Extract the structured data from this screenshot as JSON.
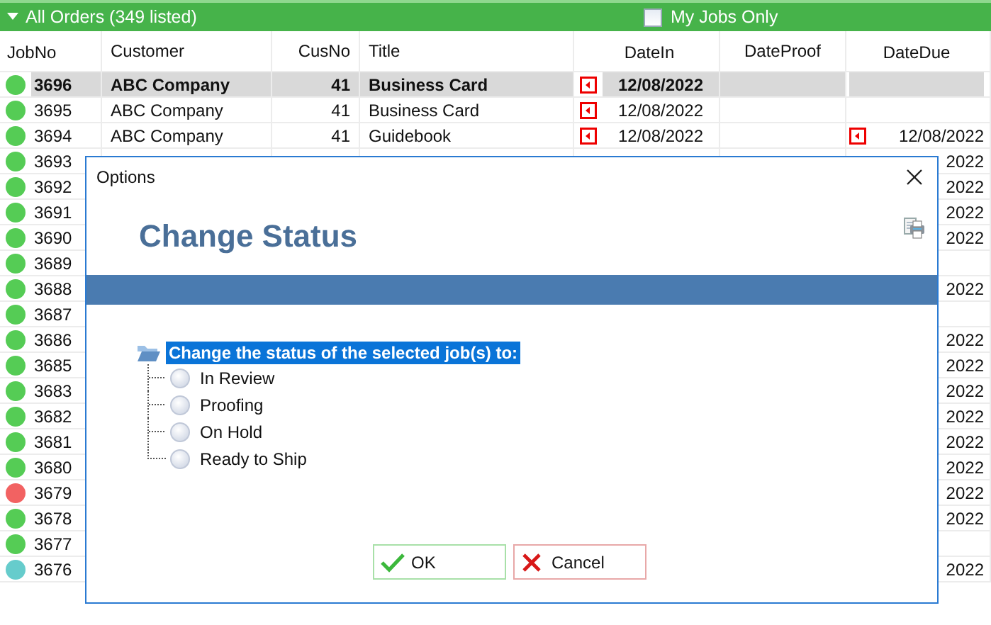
{
  "header": {
    "title": "All Orders (349 listed)",
    "expanded": true,
    "filter": {
      "label": "My Jobs Only",
      "checked": false
    }
  },
  "table": {
    "columns": [
      "JobNo",
      "Customer",
      "CusNo",
      "Title",
      "DateIn",
      "DateProof",
      "DateDue"
    ],
    "rows": [
      {
        "job_no": "3696",
        "color": "#55cc55",
        "customer": "ABC Company",
        "cus_no": "41",
        "title": "Business Card",
        "date_in": "12/08/2022",
        "date_in_flag": true,
        "selected": true
      },
      {
        "job_no": "3695",
        "color": "#55cc55",
        "customer": "ABC Company",
        "cus_no": "41",
        "title": "Business Card",
        "date_in": "12/08/2022",
        "date_in_flag": true,
        "selected": false
      },
      {
        "job_no": "3694",
        "color": "#55cc55",
        "customer": "ABC Company",
        "cus_no": "41",
        "title": "Guidebook",
        "date_in": "12/08/2022",
        "date_in_flag": true,
        "date_due": "12/08/2022",
        "date_due_flag": true,
        "selected": false
      },
      {
        "job_no": "3693",
        "color": "#55cc55",
        "date_due": "2022",
        "selected": false
      },
      {
        "job_no": "3692",
        "color": "#55cc55",
        "date_due": "2022",
        "selected": false
      },
      {
        "job_no": "3691",
        "color": "#55cc55",
        "date_due": "2022",
        "selected": false
      },
      {
        "job_no": "3690",
        "color": "#55cc55",
        "date_due": "2022",
        "selected": false
      },
      {
        "job_no": "3689",
        "color": "#55cc55",
        "selected": false
      },
      {
        "job_no": "3688",
        "color": "#55cc55",
        "date_due": "2022",
        "selected": false
      },
      {
        "job_no": "3687",
        "color": "#55cc55",
        "selected": false
      },
      {
        "job_no": "3686",
        "color": "#55cc55",
        "date_due": "2022",
        "selected": false
      },
      {
        "job_no": "3685",
        "color": "#55cc55",
        "date_due": "2022",
        "selected": false
      },
      {
        "job_no": "3683",
        "color": "#55cc55",
        "date_due": "2022",
        "selected": false
      },
      {
        "job_no": "3682",
        "color": "#55cc55",
        "date_due": "2022",
        "selected": false
      },
      {
        "job_no": "3681",
        "color": "#55cc55",
        "date_due": "2022",
        "selected": false
      },
      {
        "job_no": "3680",
        "color": "#55cc55",
        "date_due": "2022",
        "selected": false
      },
      {
        "job_no": "3679",
        "color": "#f26262",
        "date_due": "2022",
        "selected": false
      },
      {
        "job_no": "3678",
        "color": "#55cc55",
        "date_due": "2022",
        "selected": false
      },
      {
        "job_no": "3677",
        "color": "#55cc55",
        "selected": false
      },
      {
        "job_no": "3676",
        "color": "#66cccc",
        "date_due": "2022",
        "selected": false
      }
    ]
  },
  "dialog": {
    "title": "Options",
    "heading": "Change Status",
    "prompt": "Change the status of the selected job(s) to:",
    "options": [
      {
        "label": "In Review",
        "selected": false
      },
      {
        "label": "Proofing",
        "selected": false
      },
      {
        "label": "On Hold",
        "selected": false
      },
      {
        "label": "Ready to Ship",
        "selected": false
      }
    ],
    "buttons": [
      {
        "label": "OK",
        "kind": "ok"
      },
      {
        "label": "Cancel",
        "kind": "cancel"
      }
    ]
  }
}
